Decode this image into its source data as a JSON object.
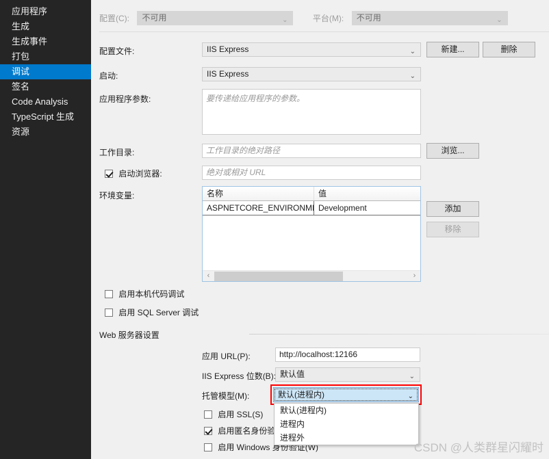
{
  "sidebar": {
    "items": [
      {
        "label": "应用程序",
        "selected": false
      },
      {
        "label": "生成",
        "selected": false
      },
      {
        "label": "生成事件",
        "selected": false
      },
      {
        "label": "打包",
        "selected": false
      },
      {
        "label": "调试",
        "selected": true
      },
      {
        "label": "签名",
        "selected": false
      },
      {
        "label": "Code Analysis",
        "selected": false
      },
      {
        "label": "TypeScript 生成",
        "selected": false
      },
      {
        "label": "资源",
        "selected": false
      }
    ],
    "background": "#252526",
    "selected_color": "#007acc"
  },
  "header": {
    "configuration_label": "配置(C):",
    "configuration_value": "不可用",
    "platform_label": "平台(M):",
    "platform_value": "不可用"
  },
  "profile": {
    "label": "配置文件:",
    "value": "IIS Express",
    "new_button": "新建...",
    "delete_button": "删除"
  },
  "launch": {
    "label": "启动:",
    "value": "IIS Express"
  },
  "app_args": {
    "label": "应用程序参数:",
    "placeholder": "要传递给应用程序的参数。",
    "value": ""
  },
  "working_dir": {
    "label": "工作目录:",
    "placeholder": "工作目录的绝对路径",
    "value": "",
    "browse_button": "浏览..."
  },
  "launch_browser": {
    "label": "启动浏览器:",
    "checked": true,
    "placeholder": "绝对或相对 URL",
    "value": ""
  },
  "env_vars": {
    "label": "环境变量:",
    "columns": [
      "名称",
      "值"
    ],
    "rows": [
      {
        "name": "ASPNETCORE_ENVIRONMENT",
        "value": "Development"
      }
    ],
    "add_button": "添加",
    "remove_button": "移除",
    "scroll_left_icon": "chevron-left-icon",
    "scroll_right_icon": "chevron-right-icon"
  },
  "native_debug": {
    "label": "启用本机代码调试",
    "checked": false
  },
  "sql_debug": {
    "label": "启用 SQL Server 调试",
    "checked": false
  },
  "web_server": {
    "section_title": "Web 服务器设置",
    "app_url_label": "应用 URL(P):",
    "app_url_value": "http://localhost:12166",
    "bitness_label": "IIS Express 位数(B):",
    "bitness_value": "默认值",
    "hosting_model_label": "托管模型(M):",
    "hosting_model_value": "默认(进程内)",
    "hosting_model_options": [
      "默认(进程内)",
      "进程内",
      "进程外"
    ],
    "highlight_color": "#ff0000",
    "ssl_label": "启用 SSL(S)",
    "ssl_checked": false,
    "anon_label": "启用匿名身份验证(",
    "anon_checked": true,
    "windows_auth_label": "启用 Windows 身份验证(W)",
    "windows_auth_checked": false
  },
  "watermark": {
    "text": "CSDN @人类群星闪耀时"
  },
  "icons": {
    "chevron_down": "⌄",
    "chevron_left": "‹",
    "chevron_right": "›"
  }
}
